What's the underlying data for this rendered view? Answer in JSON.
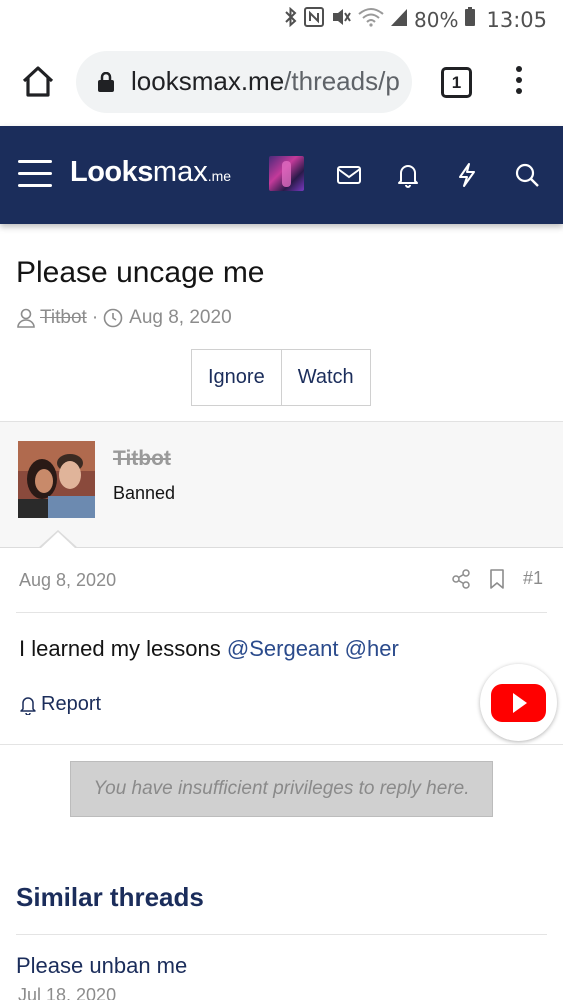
{
  "status_bar": {
    "icons": [
      "bluetooth-icon",
      "nfc-icon",
      "vibrate-icon",
      "wifi-icon",
      "signal-icon",
      "battery-icon"
    ],
    "battery": "80%",
    "time": "13:05"
  },
  "browser": {
    "url_domain": "looksmax.me",
    "url_path": "/threads/p",
    "tab_count": "1"
  },
  "site": {
    "logo_part1": "Looks",
    "logo_part2": "max",
    "logo_tld": ".me",
    "header_icons": [
      "menu-icon",
      "avatar",
      "mail-icon",
      "bell-icon",
      "lightning-icon",
      "search-icon"
    ],
    "brand_color": "#1b2d5b"
  },
  "thread": {
    "title": "Please uncage me",
    "author": "Titbot",
    "separator": "·",
    "date": "Aug 8, 2020",
    "buttons": {
      "ignore": "Ignore",
      "watch": "Watch"
    }
  },
  "post": {
    "username": "Titbot",
    "user_title": "Banned",
    "date": "Aug 8, 2020",
    "number": "#1",
    "body_text": "I learned my lessons",
    "mentions": [
      "@Sergeant",
      "@her"
    ],
    "report_label": "Report"
  },
  "reply": {
    "notice": "You have insufficient privileges to reply here."
  },
  "similar": {
    "heading": "Similar threads",
    "items": [
      {
        "title": "Please unban me",
        "date": "Jul 18, 2020"
      }
    ]
  }
}
